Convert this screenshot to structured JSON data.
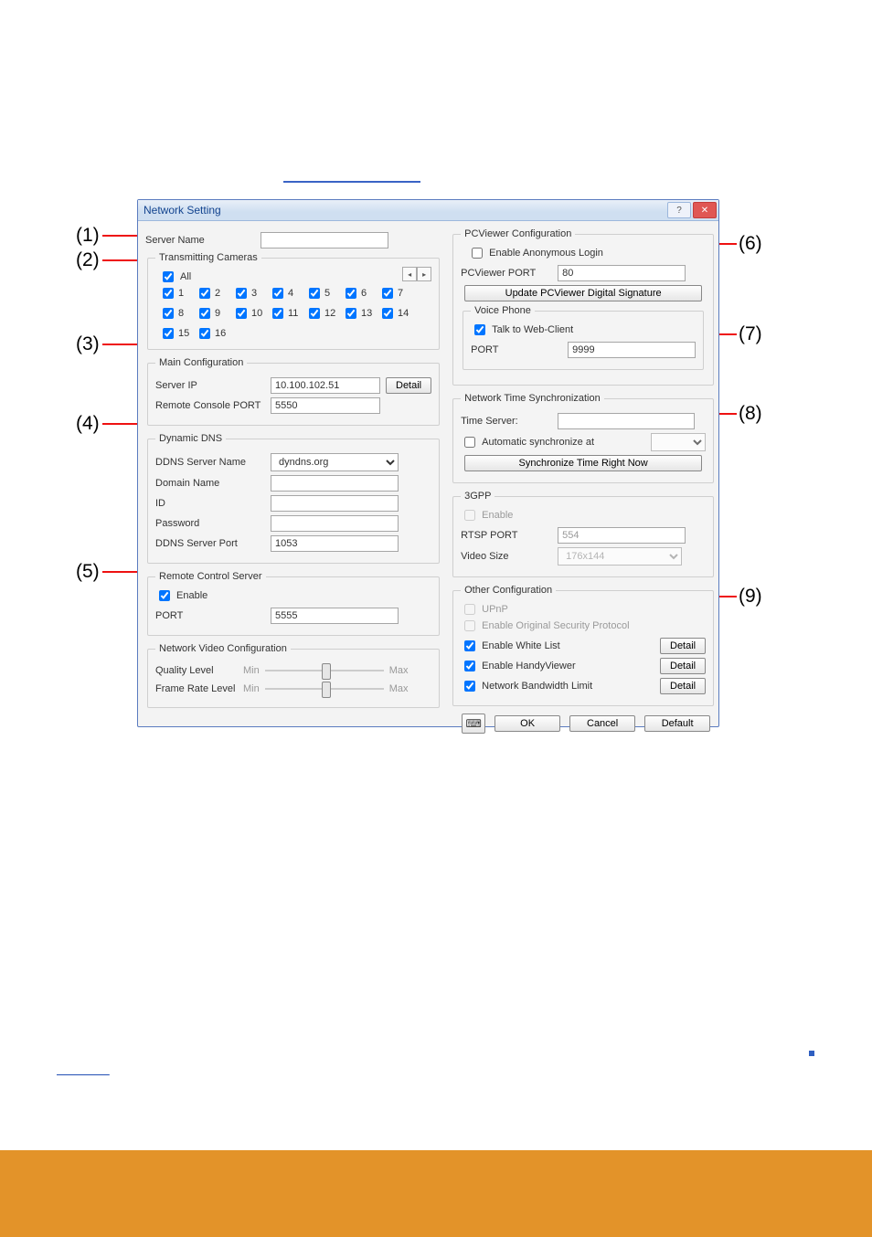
{
  "window": {
    "title": "Network Setting"
  },
  "callouts": [
    "(1)",
    "(2)",
    "(3)",
    "(4)",
    "(5)",
    "(6)",
    "(7)",
    "(8)",
    "(9)"
  ],
  "left": {
    "server_name": {
      "label": "Server Name",
      "value": ""
    },
    "transmitting": {
      "legend": "Transmitting Cameras",
      "all_label": "All",
      "cameras": [
        "1",
        "2",
        "3",
        "4",
        "5",
        "6",
        "7",
        "8",
        "9",
        "10",
        "11",
        "12",
        "13",
        "14",
        "15",
        "16"
      ]
    },
    "main": {
      "legend": "Main Configuration",
      "server_ip_label": "Server IP",
      "server_ip_value": "10.100.102.51",
      "detail": "Detail",
      "remote_console_port_label": "Remote Console PORT",
      "remote_console_port_value": "5550"
    },
    "ddns": {
      "legend": "Dynamic DNS",
      "server_name_label": "DDNS Server Name",
      "server_name_value": "dyndns.org",
      "domain_name_label": "Domain Name",
      "domain_name_value": "",
      "id_label": "ID",
      "id_value": "",
      "password_label": "Password",
      "password_value": "",
      "port_label": "DDNS Server Port",
      "port_value": "1053"
    },
    "remote": {
      "legend": "Remote Control Server",
      "enable_label": "Enable",
      "port_label": "PORT",
      "port_value": "5555"
    },
    "video": {
      "legend": "Network Video Configuration",
      "quality_label": "Quality Level",
      "frame_label": "Frame Rate Level",
      "min": "Min",
      "max": "Max"
    }
  },
  "right": {
    "pcv": {
      "legend": "PCViewer Configuration",
      "anon_label": "Enable Anonymous Login",
      "port_label": "PCViewer PORT",
      "port_value": "80",
      "update_btn": "Update PCViewer Digital Signature",
      "voice_phone_legend": "Voice Phone",
      "talk_label": "Talk to Web-Client",
      "vp_port_label": "PORT",
      "vp_port_value": "9999"
    },
    "nts": {
      "legend": "Network Time Synchronization",
      "time_server_label": "Time Server:",
      "time_server_value": "",
      "auto_sync_label": "Automatic synchronize at",
      "auto_sync_value": "",
      "sync_now_btn": "Synchronize Time Right Now"
    },
    "gpp": {
      "legend": "3GPP",
      "enable_label": "Enable",
      "rtsp_port_label": "RTSP PORT",
      "rtsp_port_value": "554",
      "video_size_label": "Video Size",
      "video_size_value": "176x144"
    },
    "other": {
      "legend": "Other Configuration",
      "upnp_label": "UPnP",
      "orig_sec_label": "Enable Original Security Protocol",
      "white_list_label": "Enable White List",
      "handy_label": "Enable HandyViewer",
      "bw_label": "Network Bandwidth Limit",
      "detail_btn": "Detail"
    }
  },
  "buttons": {
    "ok": "OK",
    "cancel": "Cancel",
    "default": "Default"
  }
}
